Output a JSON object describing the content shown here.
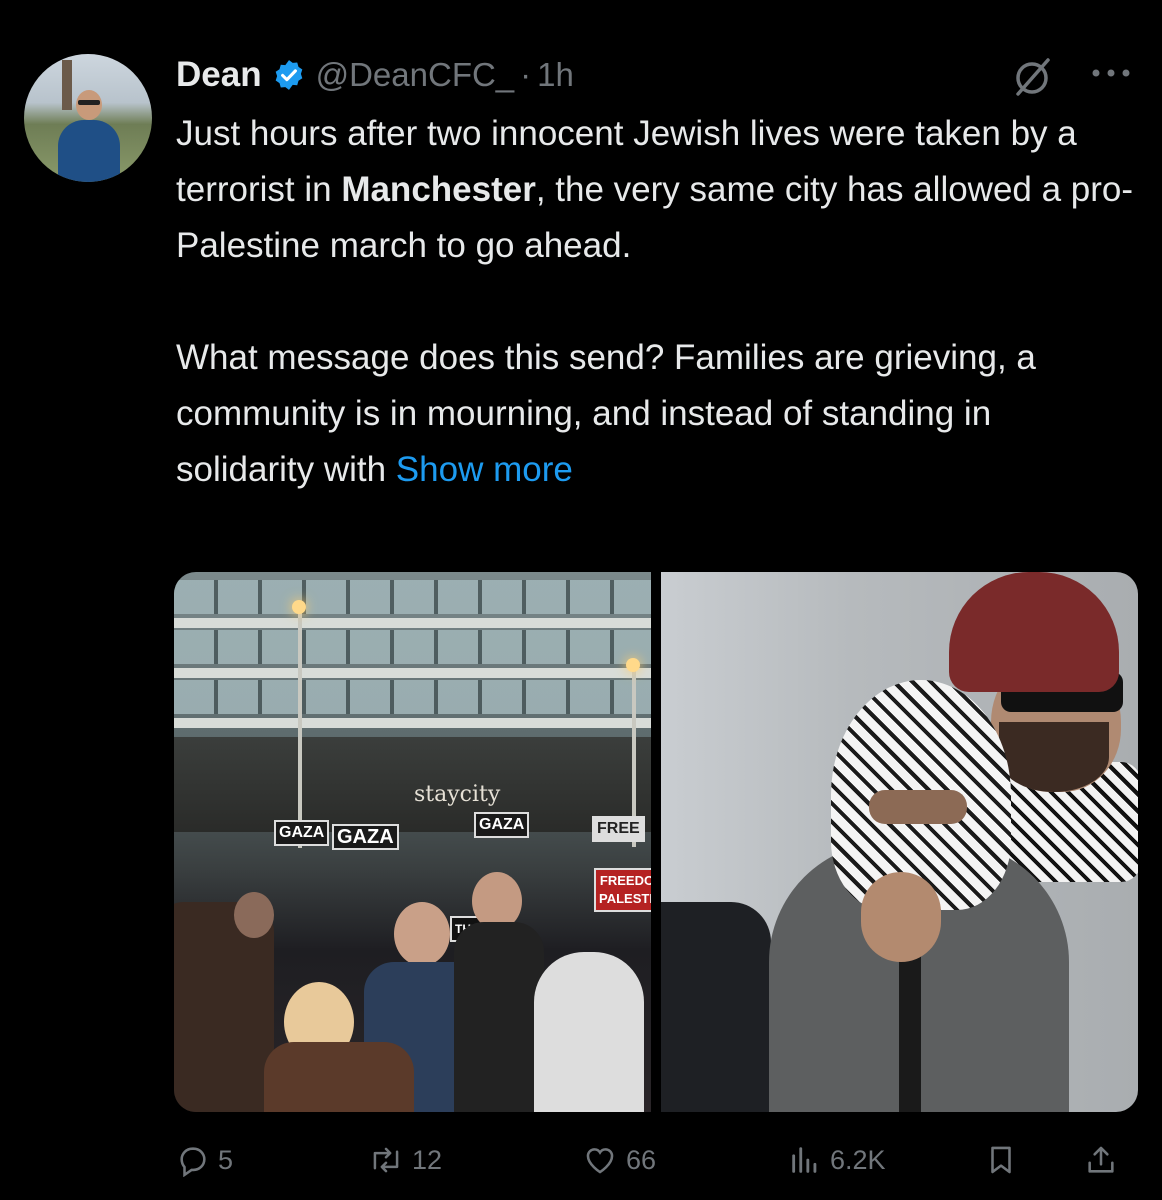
{
  "author": {
    "name": "Dean",
    "handle": "@DeanCFC_",
    "separator": "·",
    "time": "1h"
  },
  "tweet": {
    "text_part1": "Just hours after two innocent Jewish lives were taken by a terrorist in ",
    "bold_word": "Manchester",
    "text_part2": ", the very same city has allowed a pro-Palestine march to go ahead.\n\nWhat message does this send? Families are grieving, a community is in mourning, and instead of standing in solidarity with ",
    "show_more_label": "Show more"
  },
  "media": {
    "left_photo": {
      "sign_texts": [
        "GAZA",
        "GAZA",
        "GAZA",
        "FREE",
        "FREEDO PALESTIN",
        "THE"
      ],
      "storefront_text": "staycity"
    }
  },
  "actions": {
    "replies": "5",
    "reposts": "12",
    "likes": "66",
    "views": "6.2K"
  },
  "colors": {
    "background": "#000000",
    "text": "#e7e9ea",
    "secondary": "#71767b",
    "accent": "#1d9bf0"
  },
  "icons": [
    "verified-badge-icon",
    "grok-icon",
    "more-icon",
    "reply-icon",
    "repost-icon",
    "like-icon",
    "views-icon",
    "bookmark-icon",
    "share-icon"
  ]
}
